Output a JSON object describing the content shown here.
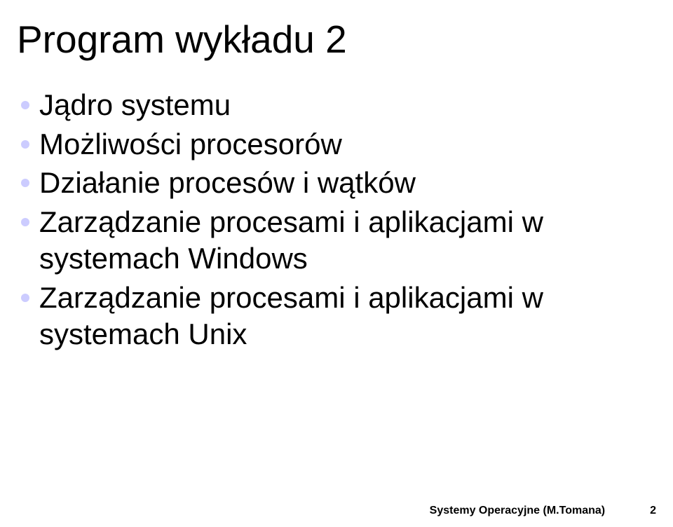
{
  "slide": {
    "title": "Program wykładu 2",
    "bullets": [
      "Jądro systemu",
      "Możliwości procesorów",
      "Działanie procesów i wątków",
      "Zarządzanie procesami i aplikacjami w systemach Windows",
      "Zarządzanie procesami i aplikacjami w systemach Unix"
    ],
    "footer": {
      "label": "Systemy Operacyjne (M.Tomana)",
      "page": "2"
    }
  }
}
